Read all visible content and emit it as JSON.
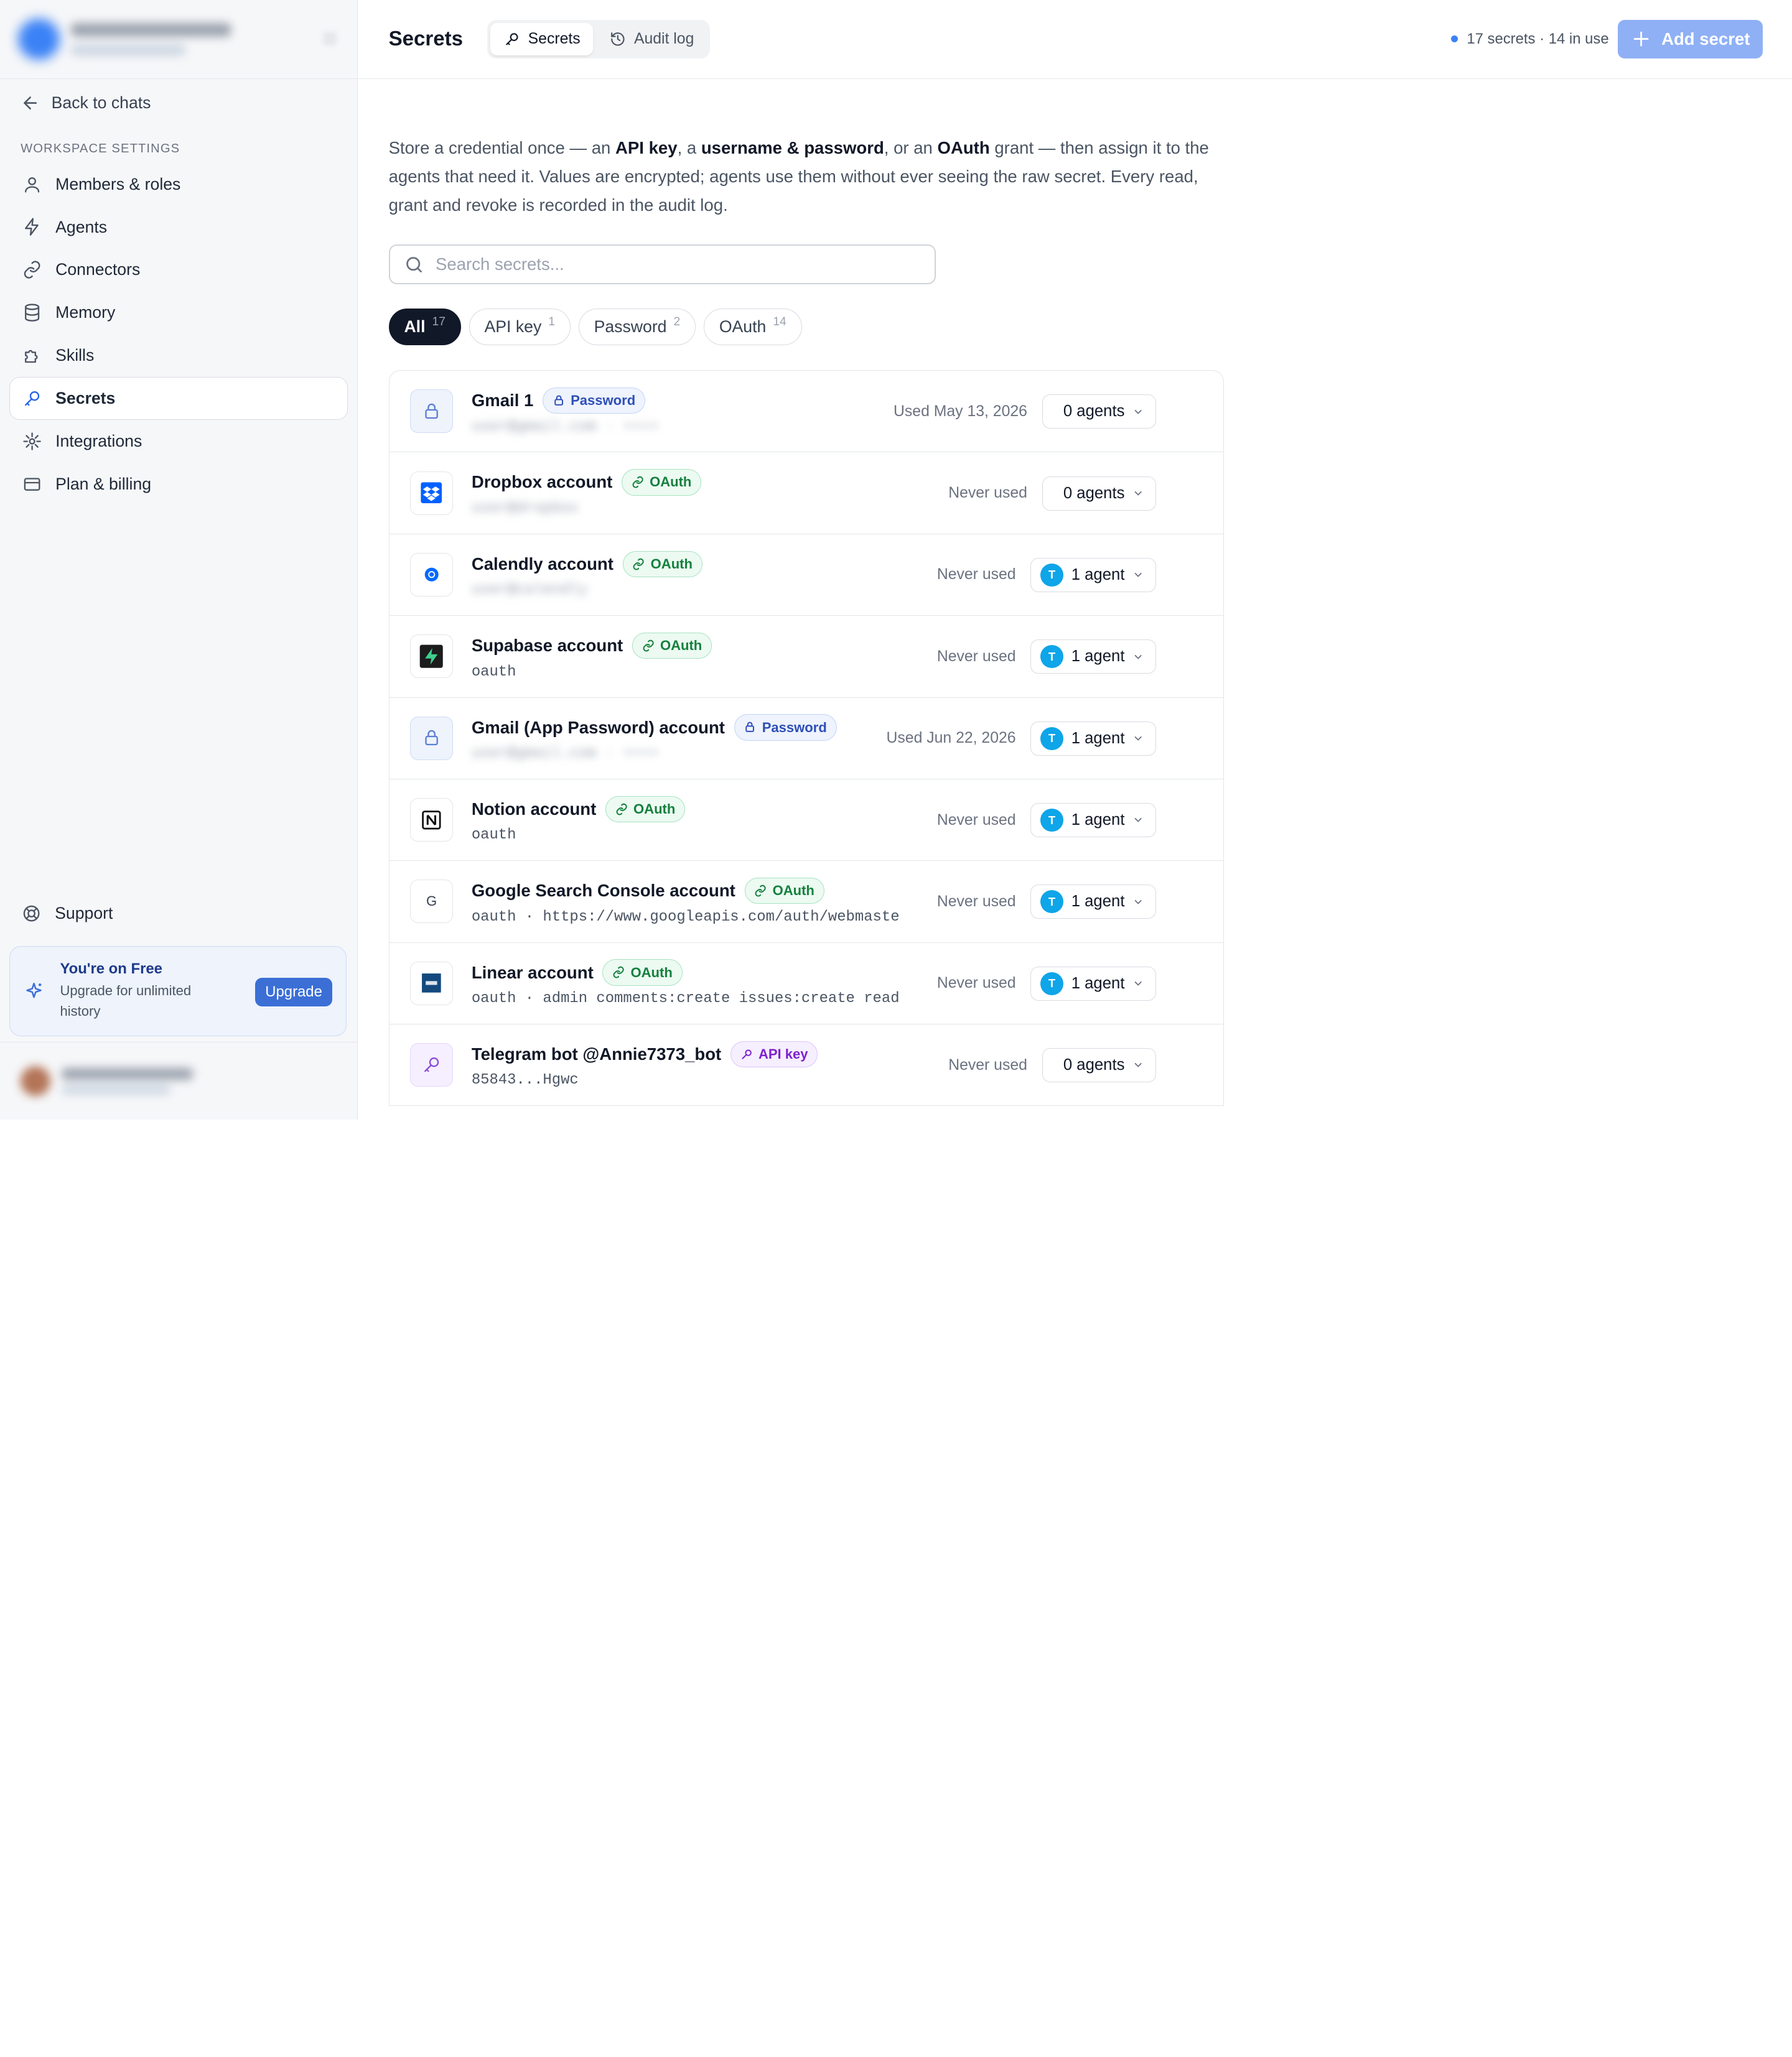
{
  "sidebar": {
    "back_label": "Back to chats",
    "section_label": "WORKSPACE SETTINGS",
    "items": [
      {
        "label": "Members & roles",
        "icon": "user-icon"
      },
      {
        "label": "Agents",
        "icon": "bolt-icon"
      },
      {
        "label": "Connectors",
        "icon": "link-icon"
      },
      {
        "label": "Memory",
        "icon": "database-icon"
      },
      {
        "label": "Skills",
        "icon": "puzzle-icon"
      },
      {
        "label": "Secrets",
        "icon": "key-icon",
        "active": true
      },
      {
        "label": "Integrations",
        "icon": "plug-icon"
      },
      {
        "label": "Plan & billing",
        "icon": "card-icon"
      }
    ],
    "support_label": "Support",
    "plan": {
      "title": "You're on Free",
      "subtitle": "Upgrade for unlimited history",
      "button": "Upgrade"
    }
  },
  "header": {
    "title": "Secrets",
    "tabs": [
      {
        "label": "Secrets",
        "active": true
      },
      {
        "label": "Audit log",
        "active": false
      }
    ],
    "status": "17 secrets · 14 in use",
    "add_button": "Add secret"
  },
  "intro": {
    "p1": "Store a credential once — an ",
    "k1": "API key",
    "p2": ", a ",
    "k2": "username & password",
    "p3": ", or an ",
    "k3": "OAuth",
    "p4": " grant — then assign it to the agents that need it. Values are encrypted; agents use them without ever seeing the raw secret. Every read, grant and revoke is recorded in the audit log."
  },
  "search": {
    "placeholder": "Search secrets..."
  },
  "filters": [
    {
      "label": "All",
      "count": "17",
      "active": true
    },
    {
      "label": "API key",
      "count": "1"
    },
    {
      "label": "Password",
      "count": "2"
    },
    {
      "label": "OAuth",
      "count": "14"
    }
  ],
  "secrets": [
    {
      "name": "Gmail 1",
      "type": "Password",
      "sub": "user@gmail.com · ••••",
      "sub_blurred": true,
      "used": "Used May 13, 2026",
      "agents": "0 agents",
      "has_avatar": false,
      "icon": "lock-icon"
    },
    {
      "name": "Dropbox account",
      "type": "OAuth",
      "sub": "user@dropbox",
      "sub_blurred": true,
      "used": "Never used",
      "agents": "0 agents",
      "has_avatar": false,
      "icon": "dropbox-icon"
    },
    {
      "name": "Calendly account",
      "type": "OAuth",
      "sub": "user@calendly",
      "sub_blurred": true,
      "used": "Never used",
      "agents": "1 agent",
      "has_avatar": true,
      "icon": "calendly-icon"
    },
    {
      "name": "Supabase account",
      "type": "OAuth",
      "sub": "oauth",
      "sub_blurred": false,
      "used": "Never used",
      "agents": "1 agent",
      "has_avatar": true,
      "icon": "supabase-icon"
    },
    {
      "name": "Gmail (App Password) account",
      "type": "Password",
      "sub": "user@gmail.com · ••••",
      "sub_blurred": true,
      "used": "Used Jun 22, 2026",
      "agents": "1 agent",
      "has_avatar": true,
      "icon": "lock-icon"
    },
    {
      "name": "Notion account",
      "type": "OAuth",
      "sub": "oauth",
      "sub_blurred": false,
      "used": "Never used",
      "agents": "1 agent",
      "has_avatar": true,
      "icon": "notion-icon"
    },
    {
      "name": "Google Search Console account",
      "type": "OAuth",
      "sub": "oauth · https://www.googleapis.com/auth/webmaste",
      "sub_blurred": false,
      "used": "Never used",
      "agents": "1 agent",
      "has_avatar": true,
      "icon": "google-icon"
    },
    {
      "name": "Linear account",
      "type": "OAuth",
      "sub": "oauth · admin comments:create issues:create read",
      "sub_blurred": false,
      "used": "Never used",
      "agents": "1 agent",
      "has_avatar": true,
      "icon": "linear-icon"
    },
    {
      "name": "Telegram bot @Annie7373_bot",
      "type": "API key",
      "sub": "85843...Hgwc",
      "sub_blurred": false,
      "used": "Never used",
      "agents": "0 agents",
      "has_avatar": false,
      "icon": "key-icon"
    }
  ],
  "agent_avatar_letter": "T",
  "colors": {
    "accent": "#3b6fd6",
    "add_button": "#8fb0f5",
    "oauth": "#15803d",
    "password": "#2e4fb8",
    "apikey": "#7e22ce"
  }
}
